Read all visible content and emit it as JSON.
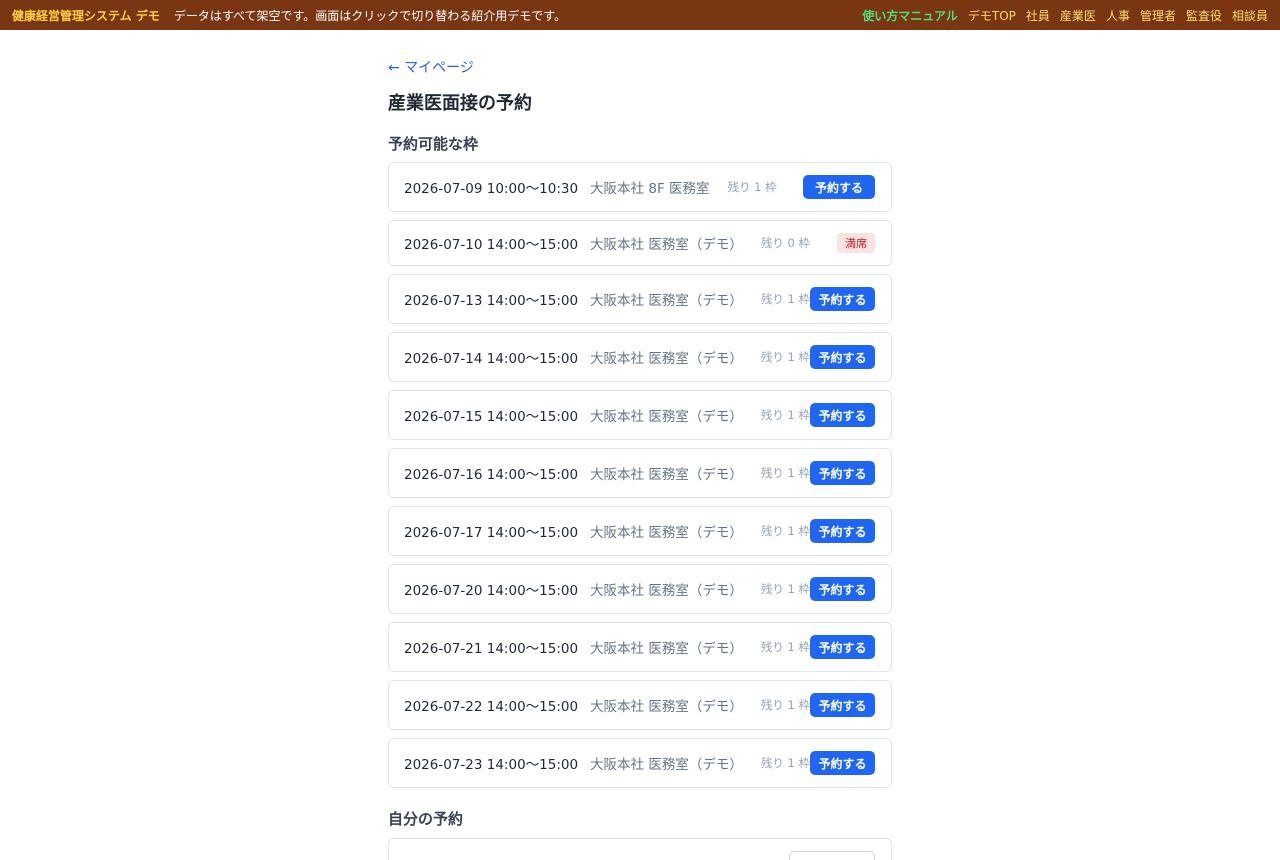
{
  "header": {
    "brand": "健康経営管理システム デモ",
    "notice": "データはすべて架空です。画面はクリックで切り替わる紹介用デモです。",
    "nav": [
      "使い方マニュアル",
      "デモTOP",
      "社員",
      "産業医",
      "人事",
      "管理者",
      "監査役",
      "相談員"
    ]
  },
  "back_link": "← マイページ",
  "page_title": "産業医面接の予約",
  "available_title": "予約可能な枠",
  "book_label": "予約する",
  "slots": [
    {
      "datetime": "2026-07-09 10:00〜10:30",
      "location": "大阪本社 8F 医務室",
      "remaining": "残り 1 枠",
      "status": "available"
    },
    {
      "datetime": "2026-07-10 14:00〜15:00",
      "location": "大阪本社 医務室（デモ）",
      "remaining": "残り 0 枠",
      "status": "full",
      "badge": "満席"
    },
    {
      "datetime": "2026-07-13 14:00〜15:00",
      "location": "大阪本社 医務室（デモ）",
      "remaining": "残り 1 枠",
      "status": "available"
    },
    {
      "datetime": "2026-07-14 14:00〜15:00",
      "location": "大阪本社 医務室（デモ）",
      "remaining": "残り 1 枠",
      "status": "available"
    },
    {
      "datetime": "2026-07-15 14:00〜15:00",
      "location": "大阪本社 医務室（デモ）",
      "remaining": "残り 1 枠",
      "status": "available"
    },
    {
      "datetime": "2026-07-16 14:00〜15:00",
      "location": "大阪本社 医務室（デモ）",
      "remaining": "残り 1 枠",
      "status": "available"
    },
    {
      "datetime": "2026-07-17 14:00〜15:00",
      "location": "大阪本社 医務室（デモ）",
      "remaining": "残り 1 枠",
      "status": "available"
    },
    {
      "datetime": "2026-07-20 14:00〜15:00",
      "location": "大阪本社 医務室（デモ）",
      "remaining": "残り 1 枠",
      "status": "available"
    },
    {
      "datetime": "2026-07-21 14:00〜15:00",
      "location": "大阪本社 医務室（デモ）",
      "remaining": "残り 1 枠",
      "status": "available"
    },
    {
      "datetime": "2026-07-22 14:00〜15:00",
      "location": "大阪本社 医務室（デモ）",
      "remaining": "残り 1 枠",
      "status": "available"
    },
    {
      "datetime": "2026-07-23 14:00〜15:00",
      "location": "大阪本社 医務室（デモ）",
      "remaining": "残り 1 枠",
      "status": "available"
    }
  ],
  "my_reservations_title": "自分の予約"
}
